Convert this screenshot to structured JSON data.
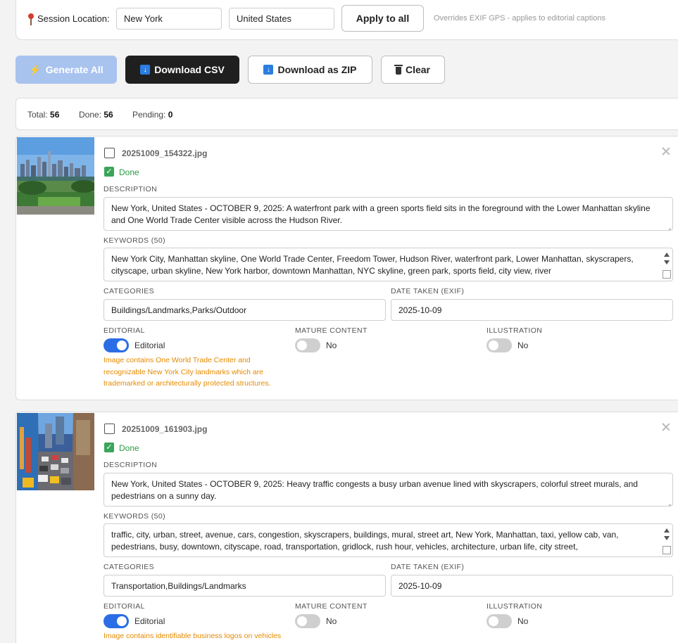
{
  "session": {
    "label": "Session Location:",
    "city": "New York",
    "country": "United States",
    "apply_label": "Apply to all",
    "note": "Overrides EXIF GPS - applies to editorial captions"
  },
  "toolbar": {
    "generate_label": "Generate All",
    "csv_label": "Download CSV",
    "zip_label": "Download as ZIP",
    "clear_label": "Clear"
  },
  "stats": {
    "total_label": "Total:",
    "total": "56",
    "done_label": "Done:",
    "done": "56",
    "pending_label": "Pending:",
    "pending": "0"
  },
  "labels": {
    "description": "DESCRIPTION",
    "keywords": "KEYWORDS (50)",
    "categories": "CATEGORIES",
    "date_taken": "DATE TAKEN (EXIF)",
    "editorial": "EDITORIAL",
    "mature": "MATURE CONTENT",
    "illustration": "ILLUSTRATION",
    "done": "Done",
    "editorial_on": "Editorial",
    "no": "No"
  },
  "cards": [
    {
      "filename": "20251009_154322.jpg",
      "description": "New York, United States - OCTOBER 9, 2025: A waterfront park with a green sports field sits in the foreground with the Lower Manhattan skyline and One World Trade Center visible across the Hudson River.",
      "keywords": "New York City, Manhattan skyline, One World Trade Center, Freedom Tower, Hudson River, waterfront park, Lower Manhattan, skyscrapers, cityscape, urban skyline, New York harbor, downtown Manhattan, NYC skyline, green park, sports field, city view, river",
      "categories": "Buildings/Landmarks,Parks/Outdoor",
      "date": "2025-10-09",
      "editorial_note": "Image contains One World Trade Center and recognizable New York City landmarks which are trademarked or architecturally protected structures."
    },
    {
      "filename": "20251009_161903.jpg",
      "description": "New York, United States - OCTOBER 9, 2025: Heavy traffic congests a busy urban avenue lined with skyscrapers, colorful street murals, and pedestrians on a sunny day.",
      "keywords": "traffic, city, urban, street, avenue, cars, congestion, skyscrapers, buildings, mural, street art, New York, Manhattan, taxi, yellow cab, van, pedestrians, busy, downtown, cityscape, road, transportation, gridlock, rush hour, vehicles, architecture, urban life, city street,",
      "categories": "Transportation,Buildings/Landmarks",
      "date": "2025-10-09",
      "editorial_note": "Image contains identifiable business logos on vehicles"
    }
  ],
  "colors": {
    "accent_blue": "#2b6de5",
    "success_green": "#2a9d44",
    "warning_orange": "#e58a00",
    "dark_button": "#1f1f1f",
    "disabled_button": "#a9c3ef"
  }
}
